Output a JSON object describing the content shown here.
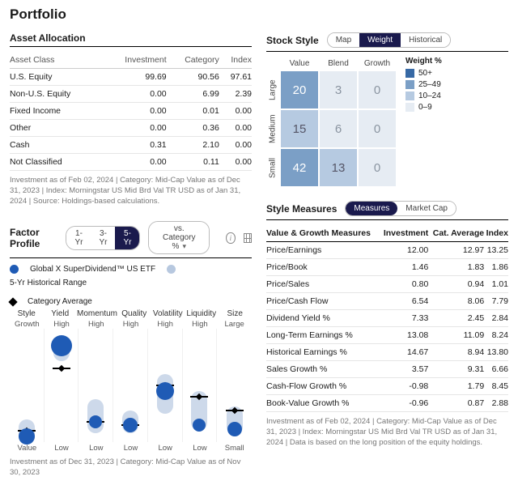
{
  "title": "Portfolio",
  "assetAllocation": {
    "heading": "Asset Allocation",
    "headers": {
      "class": "Asset Class",
      "inv": "Investment",
      "cat": "Category",
      "idx": "Index"
    },
    "rows": [
      {
        "class": "U.S. Equity",
        "inv": "99.69",
        "cat": "90.56",
        "idx": "97.61"
      },
      {
        "class": "Non-U.S. Equity",
        "inv": "0.00",
        "cat": "6.99",
        "idx": "2.39"
      },
      {
        "class": "Fixed Income",
        "inv": "0.00",
        "cat": "0.01",
        "idx": "0.00"
      },
      {
        "class": "Other",
        "inv": "0.00",
        "cat": "0.36",
        "idx": "0.00"
      },
      {
        "class": "Cash",
        "inv": "0.31",
        "cat": "2.10",
        "idx": "0.00"
      },
      {
        "class": "Not Classified",
        "inv": "0.00",
        "cat": "0.11",
        "idx": "0.00"
      }
    ],
    "footnote": "Investment as of Feb 02, 2024 | Category: Mid-Cap Value as of Dec 31, 2023 | Index: Morningstar US Mid Brd Val TR USD as of Jan 31, 2024 | Source: Holdings-based calculations."
  },
  "stockStyle": {
    "heading": "Stock Style",
    "tabs": {
      "map": "Map",
      "weight": "Weight",
      "historical": "Historical"
    },
    "cols": {
      "value": "Value",
      "blend": "Blend",
      "growth": "Growth"
    },
    "rows": {
      "large": "Large",
      "medium": "Medium",
      "small": "Small"
    },
    "cells": [
      [
        "20",
        "3",
        "0"
      ],
      [
        "15",
        "6",
        "0"
      ],
      [
        "42",
        "13",
        "0"
      ]
    ],
    "weights": [
      [
        "w25",
        "w0",
        "w0"
      ],
      [
        "w10",
        "w0",
        "w0"
      ],
      [
        "w25",
        "w10",
        "w0"
      ]
    ],
    "legend": {
      "title": "Weight %",
      "items": [
        {
          "cls": "w50",
          "label": "50+"
        },
        {
          "cls": "w25",
          "label": "25–49"
        },
        {
          "cls": "w10",
          "label": "10–24"
        },
        {
          "cls": "w0",
          "label": "0–9"
        }
      ]
    }
  },
  "factorProfile": {
    "heading": "Factor Profile",
    "tabs": {
      "y1": "1-Yr",
      "y3": "3-Yr",
      "y5": "5-Yr"
    },
    "compare": "vs. Category %",
    "legend": {
      "series": "Global X SuperDividend™ US ETF",
      "range": "5-Yr Historical Range",
      "category": "Category Average"
    },
    "factors": [
      {
        "name": "Style",
        "top": "Growth",
        "bottom": "Value",
        "rangeTop": 80,
        "rangeH": 20,
        "valPos": 95,
        "valSize": 20,
        "catPos": 90
      },
      {
        "name": "Yield",
        "top": "High",
        "bottom": "Low",
        "rangeTop": 8,
        "rangeH": 20,
        "valPos": 15,
        "valSize": 26,
        "catPos": 35
      },
      {
        "name": "Momentum",
        "top": "High",
        "bottom": "Low",
        "rangeTop": 62,
        "rangeH": 30,
        "valPos": 82,
        "valSize": 16,
        "catPos": 82
      },
      {
        "name": "Quality",
        "top": "High",
        "bottom": "Low",
        "rangeTop": 72,
        "rangeH": 20,
        "valPos": 85,
        "valSize": 18,
        "catPos": 85
      },
      {
        "name": "Volatility",
        "top": "High",
        "bottom": "Low",
        "rangeTop": 40,
        "rangeH": 35,
        "valPos": 55,
        "valSize": 22,
        "catPos": 50
      },
      {
        "name": "Liquidity",
        "top": "High",
        "bottom": "Low",
        "rangeTop": 55,
        "rangeH": 35,
        "valPos": 85,
        "valSize": 16,
        "catPos": 60
      },
      {
        "name": "Size",
        "top": "Large",
        "bottom": "Small",
        "rangeTop": 68,
        "rangeH": 25,
        "valPos": 88,
        "valSize": 18,
        "catPos": 72
      }
    ],
    "footnote": "Investment as of Dec 31, 2023 | Category: Mid-Cap Value as of Nov 30, 2023"
  },
  "styleMeasures": {
    "heading": "Style Measures",
    "tabs": {
      "measures": "Measures",
      "marketcap": "Market Cap"
    },
    "headers": {
      "name": "Value & Growth Measures",
      "inv": "Investment",
      "cat": "Cat. Average",
      "idx": "Index"
    },
    "rows": [
      {
        "name": "Price/Earnings",
        "inv": "12.00",
        "cat": "12.97",
        "idx": "13.25"
      },
      {
        "name": "Price/Book",
        "inv": "1.46",
        "cat": "1.83",
        "idx": "1.86"
      },
      {
        "name": "Price/Sales",
        "inv": "0.80",
        "cat": "0.94",
        "idx": "1.01"
      },
      {
        "name": "Price/Cash Flow",
        "inv": "6.54",
        "cat": "8.06",
        "idx": "7.79"
      },
      {
        "name": "Dividend Yield %",
        "inv": "7.33",
        "cat": "2.45",
        "idx": "2.84"
      },
      {
        "name": "Long-Term Earnings %",
        "inv": "13.08",
        "cat": "11.09",
        "idx": "8.24"
      },
      {
        "name": "Historical Earnings %",
        "inv": "14.67",
        "cat": "8.94",
        "idx": "13.80"
      },
      {
        "name": "Sales Growth %",
        "inv": "3.57",
        "cat": "9.31",
        "idx": "6.66"
      },
      {
        "name": "Cash-Flow Growth %",
        "inv": "-0.98",
        "cat": "1.79",
        "idx": "8.45"
      },
      {
        "name": "Book-Value Growth %",
        "inv": "-0.96",
        "cat": "0.87",
        "idx": "2.88"
      }
    ],
    "footnote": "Investment as of Feb 02, 2024 | Category: Mid-Cap Value as of Dec 31, 2023 | Index: Morningstar US Mid Brd Val TR USD as of Jan 31, 2024 | Data is based on the long position of the equity holdings."
  }
}
